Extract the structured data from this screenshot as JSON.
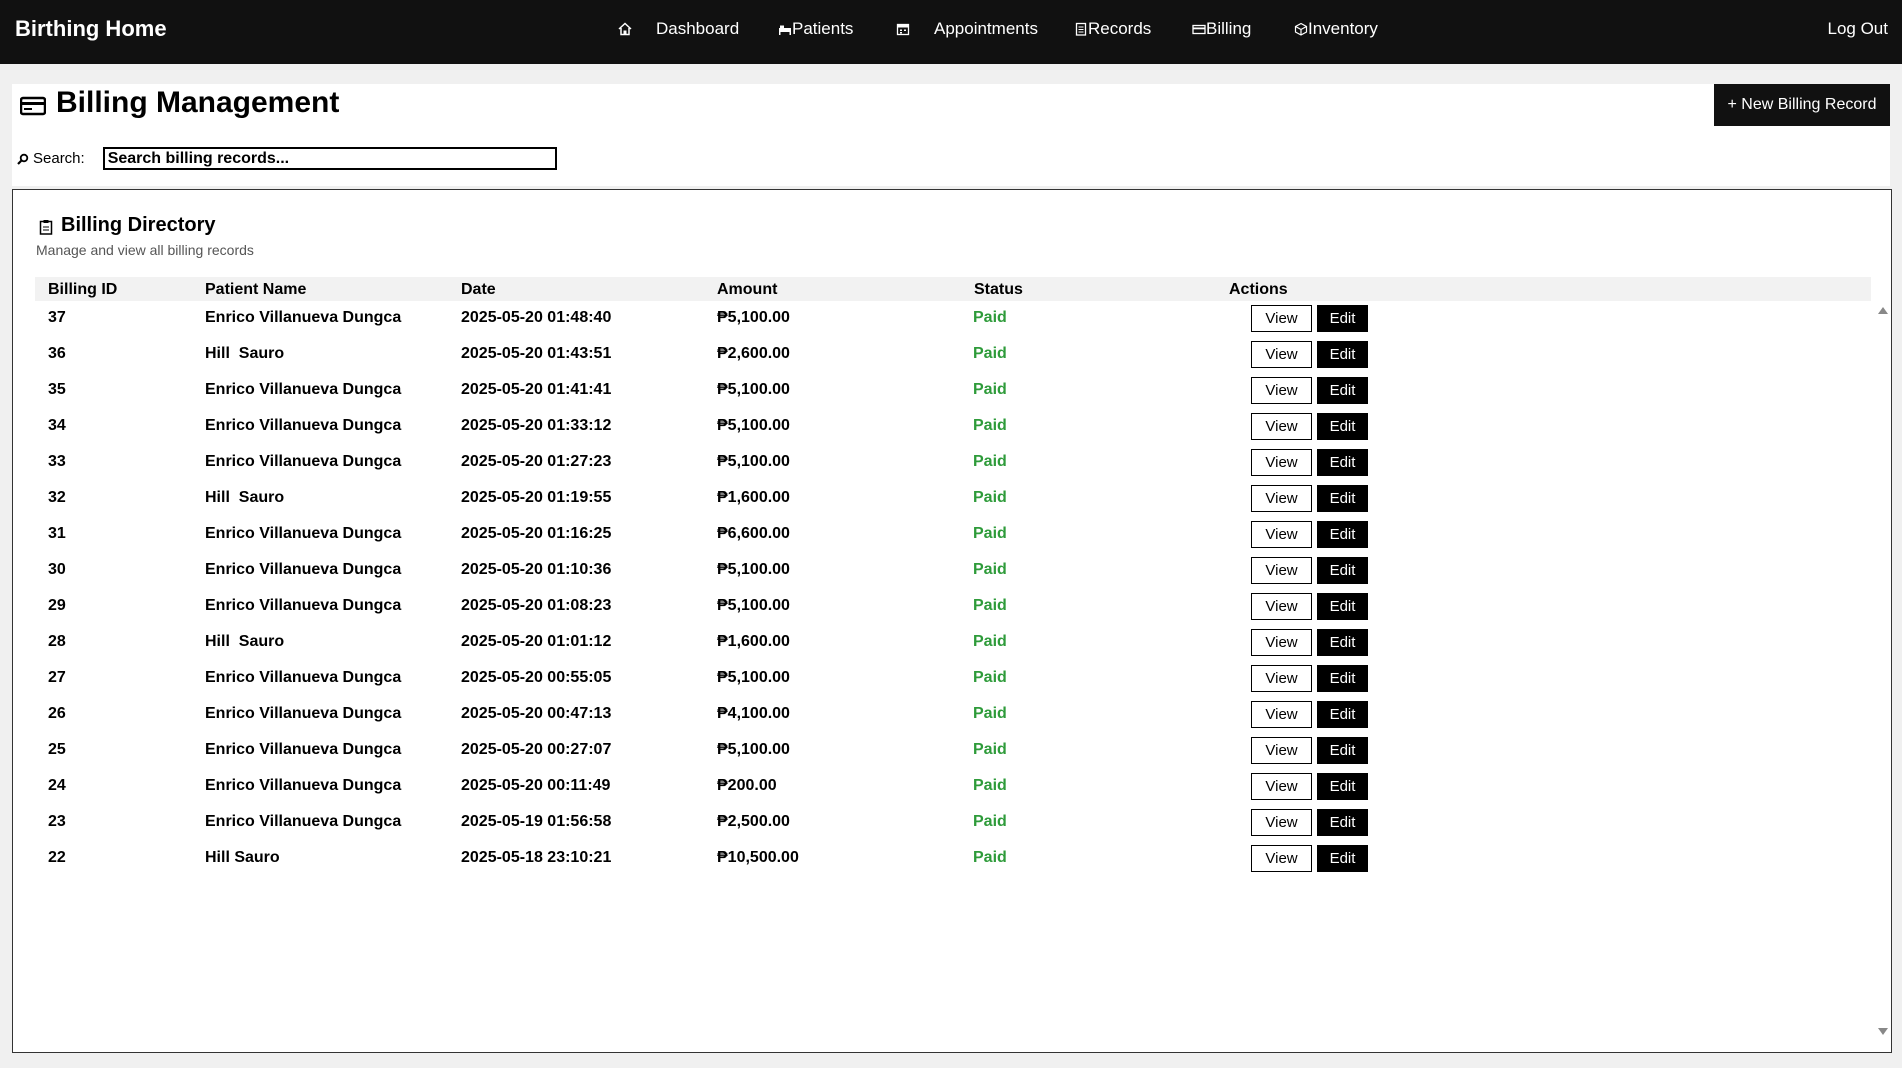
{
  "app": {
    "brand": "Birthing Home",
    "nav": [
      {
        "label": "Dashboard",
        "icon": "home-icon"
      },
      {
        "label": "Patients",
        "icon": "bed-icon"
      },
      {
        "label": "Appointments",
        "icon": "calendar-icon"
      },
      {
        "label": "Records",
        "icon": "document-icon"
      },
      {
        "label": "Billing",
        "icon": "credit-card-icon"
      },
      {
        "label": "Inventory",
        "icon": "box-icon"
      }
    ],
    "logout": "Log Out"
  },
  "page": {
    "title": "Billing Management",
    "title_icon": "credit-card-icon",
    "new_button": "+ New Billing Record",
    "search_label": "Search:",
    "search_placeholder": "Search billing records...",
    "search_icon": "magnifier-icon"
  },
  "directory": {
    "title": "Billing Directory",
    "title_icon": "clipboard-icon",
    "subtitle": "Manage and view all billing records",
    "headers": {
      "id": "Billing ID",
      "patient": "Patient Name",
      "date": "Date",
      "amount": "Amount",
      "status": "Status",
      "actions": "Actions"
    },
    "view_label": "View",
    "edit_label": "Edit",
    "status_color": "#2e9b3a",
    "rows": [
      {
        "id": "37",
        "patient": "Enrico Villanueva Dungca",
        "date": "2025-05-20 01:48:40",
        "amount": "₱5,100.00",
        "status": "Paid"
      },
      {
        "id": "36",
        "patient": "Hill  Sauro",
        "date": "2025-05-20 01:43:51",
        "amount": "₱2,600.00",
        "status": "Paid"
      },
      {
        "id": "35",
        "patient": "Enrico Villanueva Dungca",
        "date": "2025-05-20 01:41:41",
        "amount": "₱5,100.00",
        "status": "Paid"
      },
      {
        "id": "34",
        "patient": "Enrico Villanueva Dungca",
        "date": "2025-05-20 01:33:12",
        "amount": "₱5,100.00",
        "status": "Paid"
      },
      {
        "id": "33",
        "patient": "Enrico Villanueva Dungca",
        "date": "2025-05-20 01:27:23",
        "amount": "₱5,100.00",
        "status": "Paid"
      },
      {
        "id": "32",
        "patient": "Hill  Sauro",
        "date": "2025-05-20 01:19:55",
        "amount": "₱1,600.00",
        "status": "Paid"
      },
      {
        "id": "31",
        "patient": "Enrico Villanueva Dungca",
        "date": "2025-05-20 01:16:25",
        "amount": "₱6,600.00",
        "status": "Paid"
      },
      {
        "id": "30",
        "patient": "Enrico Villanueva Dungca",
        "date": "2025-05-20 01:10:36",
        "amount": "₱5,100.00",
        "status": "Paid"
      },
      {
        "id": "29",
        "patient": "Enrico Villanueva Dungca",
        "date": "2025-05-20 01:08:23",
        "amount": "₱5,100.00",
        "status": "Paid"
      },
      {
        "id": "28",
        "patient": "Hill  Sauro",
        "date": "2025-05-20 01:01:12",
        "amount": "₱1,600.00",
        "status": "Paid"
      },
      {
        "id": "27",
        "patient": "Enrico Villanueva Dungca",
        "date": "2025-05-20 00:55:05",
        "amount": "₱5,100.00",
        "status": "Paid"
      },
      {
        "id": "26",
        "patient": "Enrico Villanueva Dungca",
        "date": "2025-05-20 00:47:13",
        "amount": "₱4,100.00",
        "status": "Paid"
      },
      {
        "id": "25",
        "patient": "Enrico Villanueva Dungca",
        "date": "2025-05-20 00:27:07",
        "amount": "₱5,100.00",
        "status": "Paid"
      },
      {
        "id": "24",
        "patient": "Enrico Villanueva Dungca",
        "date": "2025-05-20 00:11:49",
        "amount": "₱200.00",
        "status": "Paid"
      },
      {
        "id": "23",
        "patient": "Enrico Villanueva Dungca",
        "date": "2025-05-19 01:56:58",
        "amount": "₱2,500.00",
        "status": "Paid"
      },
      {
        "id": "22",
        "patient": "Hill Sauro",
        "date": "2025-05-18 23:10:21",
        "amount": "₱10,500.00",
        "status": "Paid"
      }
    ]
  }
}
